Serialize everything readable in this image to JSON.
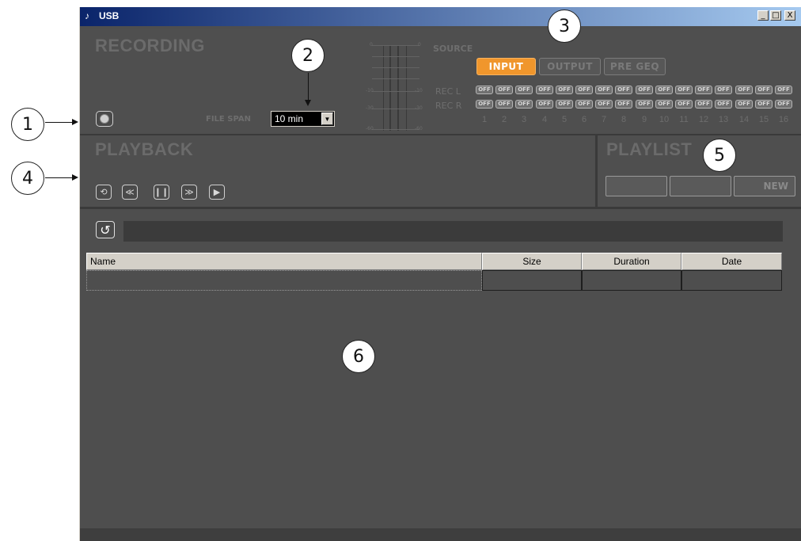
{
  "window": {
    "title": "USB",
    "minimize_icon": "minimize-icon",
    "maximize_icon": "maximize-icon",
    "close_icon": "close-icon",
    "minimize_glyph": "_",
    "maximize_glyph": "□",
    "close_glyph": "X"
  },
  "recording": {
    "title": "RECORDING",
    "file_span_label": "FILE SPAN",
    "file_span_value": "10 min",
    "record_icon": "record-icon",
    "meter_scale": [
      "0",
      "-10",
      "-30",
      "-60"
    ]
  },
  "source": {
    "label": "SOURCE",
    "buttons": [
      "INPUT",
      "OUTPUT",
      "PRE GEQ"
    ],
    "active": "INPUT",
    "rec_l_label": "REC L",
    "rec_r_label": "REC R",
    "cell_label": "OFF",
    "channels": [
      "1",
      "2",
      "3",
      "4",
      "5",
      "6",
      "7",
      "8",
      "9",
      "10",
      "11",
      "12",
      "13",
      "14",
      "15",
      "16"
    ]
  },
  "playback": {
    "title": "PLAYBACK",
    "controls": [
      "loop-icon",
      "rewind-icon",
      "pause-icon",
      "fast-forward-icon",
      "play-icon"
    ]
  },
  "playlist": {
    "title": "PLAYLIST",
    "buttons": [
      "",
      "",
      "NEW"
    ]
  },
  "browser": {
    "refresh_icon": "refresh-icon",
    "path": ""
  },
  "table": {
    "columns": [
      "Name",
      "Size",
      "Duration",
      "Date"
    ],
    "rows": [
      [
        "",
        "",
        "",
        ""
      ]
    ]
  },
  "callouts": [
    "1",
    "2",
    "3",
    "4",
    "5",
    "6"
  ],
  "colors": {
    "accent": "#f0962c",
    "panel": "#4f4f4f",
    "title_gradient_start": "#0a246a",
    "title_gradient_end": "#a6caf0"
  }
}
